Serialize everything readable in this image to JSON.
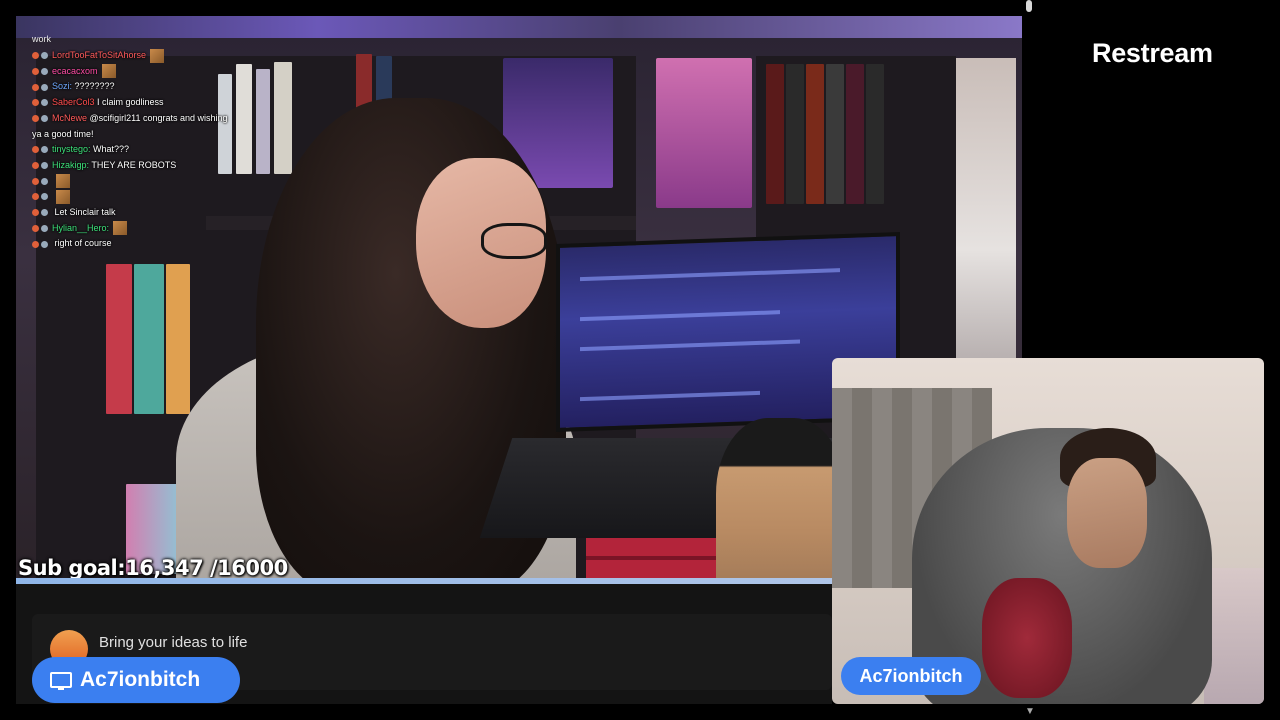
{
  "brand": {
    "name": "Restream"
  },
  "chat": {
    "header": "work",
    "messages": [
      {
        "user": "LordTooFatToSitAhorse",
        "color": "#ff5a5a",
        "text": ""
      },
      {
        "user": "ecacacxom",
        "color": "#ff4da6",
        "text": ""
      },
      {
        "user": "Sozi:",
        "color": "#6fa8ff",
        "text": "????????"
      },
      {
        "user": "SaberCol3",
        "color": "#ff4d4d",
        "text": "I claim godliness"
      },
      {
        "user": "McNewe",
        "color": "#ff5a5a",
        "text": "@scifigirl211 congrats and wishing ya a good time!"
      },
      {
        "user": "tinystego:",
        "color": "#3de07a",
        "text": "What???"
      },
      {
        "user": "Hizakigp:",
        "color": "#3de07a",
        "text": "THEY ARE ROBOTS"
      },
      {
        "user": "",
        "color": "#3b5bff",
        "text": ""
      },
      {
        "user": "",
        "color": "#3b5bff",
        "text": ""
      },
      {
        "user": "",
        "color": "#3b5bff",
        "text": "Let Sinclair talk"
      },
      {
        "user": "Hylian__Hero:",
        "color": "#3de07a",
        "text": ""
      },
      {
        "user": "",
        "color": "#6a5cff",
        "text": "right of course"
      }
    ]
  },
  "stream": {
    "sub_goal": "Sub goal:16,347 /16000",
    "sub_goal_progress": 1.0
  },
  "notification": {
    "text": "Bring your ideas to life"
  },
  "participants": {
    "screen_share_name": "Ac7ionbitch",
    "camera_name": "Ac7ionbitch"
  },
  "colors": {
    "accent": "#3b7ff0",
    "background": "#000000"
  }
}
